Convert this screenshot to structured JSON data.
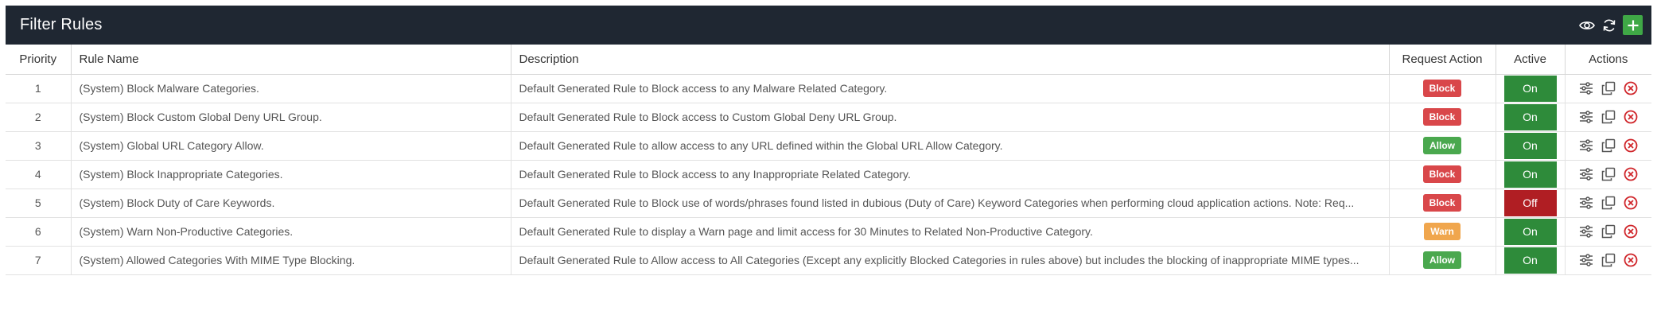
{
  "header": {
    "title": "Filter Rules",
    "icons": [
      "eye-icon",
      "refresh-icon",
      "plus-icon"
    ]
  },
  "columns": {
    "priority": "Priority",
    "rule_name": "Rule Name",
    "description": "Description",
    "request_action": "Request Action",
    "active": "Active",
    "actions": "Actions"
  },
  "colors": {
    "header_bg": "#1f2732",
    "add_button": "#3fa846",
    "block": "#d9474a",
    "allow": "#4aa84e",
    "warn": "#f0a64d",
    "on": "#2e8b3a",
    "off": "#b01e23",
    "delete_icon": "#d0262b"
  },
  "rows": [
    {
      "priority": "1",
      "name": "(System) Block Malware Categories.",
      "description": "Default Generated Rule to Block access to any Malware Related Category.",
      "action": "Block",
      "action_type": "block",
      "active": "On",
      "active_state": "on"
    },
    {
      "priority": "2",
      "name": "(System) Block Custom Global Deny URL Group.",
      "description": "Default Generated Rule to Block access to Custom Global Deny URL Group.",
      "action": "Block",
      "action_type": "block",
      "active": "On",
      "active_state": "on"
    },
    {
      "priority": "3",
      "name": "(System) Global URL Category Allow.",
      "description": "Default Generated Rule to allow access to any URL defined within the Global URL Allow Category.",
      "action": "Allow",
      "action_type": "allow",
      "active": "On",
      "active_state": "on"
    },
    {
      "priority": "4",
      "name": "(System) Block Inappropriate Categories.",
      "description": "Default Generated Rule to Block access to any Inappropriate Related Category.",
      "action": "Block",
      "action_type": "block",
      "active": "On",
      "active_state": "on"
    },
    {
      "priority": "5",
      "name": "(System) Block Duty of Care Keywords.",
      "description": "Default Generated Rule to Block use of words/phrases found listed in dubious (Duty of Care) Keyword Categories when performing cloud application actions. Note: Req...",
      "action": "Block",
      "action_type": "block",
      "active": "Off",
      "active_state": "off"
    },
    {
      "priority": "6",
      "name": "(System) Warn Non-Productive Categories.",
      "description": "Default Generated Rule to display a Warn page and limit access for 30 Minutes to Related Non-Productive Category.",
      "action": "Warn",
      "action_type": "warn",
      "active": "On",
      "active_state": "on"
    },
    {
      "priority": "7",
      "name": "(System) Allowed Categories With MIME Type Blocking.",
      "description": "Default Generated Rule to Allow access to All Categories (Except any explicitly Blocked Categories in rules above) but includes the blocking of inappropriate MIME types...",
      "action": "Allow",
      "action_type": "allow",
      "active": "On",
      "active_state": "on"
    }
  ],
  "row_action_icons": [
    "sliders-icon",
    "copy-icon",
    "delete-icon"
  ]
}
